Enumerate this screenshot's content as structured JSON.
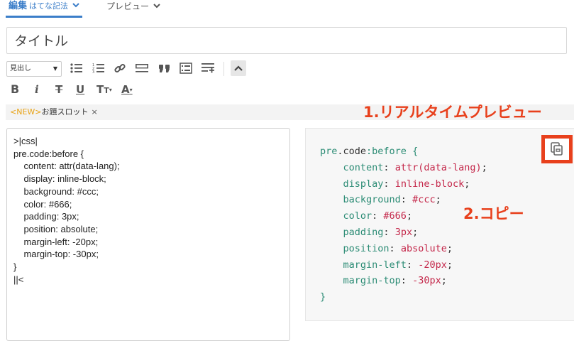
{
  "tabs": {
    "edit_label": "編集",
    "edit_mode": "はてな記法",
    "preview_label": "プレビュー"
  },
  "title_field": {
    "placeholder": "タイトル"
  },
  "toolbar": {
    "heading_select": "見出し"
  },
  "toolbar2": {
    "bold": "B",
    "italic": "i",
    "strike": "T",
    "underline": "U",
    "font_size": "T",
    "font_size_small": "T",
    "color": "A"
  },
  "topic_slot": {
    "new_badge": "<NEW>",
    "label": "お題スロット",
    "close": "×"
  },
  "annotations": {
    "realtime_preview": "1.リアルタイムプレビュー",
    "copy": "2.コピー"
  },
  "editor": {
    "content": ">|css|\npre.code:before {\n    content: attr(data-lang);\n    display: inline-block;\n    background: #ccc;\n    color: #666;\n    padding: 3px;\n    position: absolute;\n    margin-left: -20px;\n    margin-top: -30px;\n}\n||<"
  },
  "preview": {
    "selector_a": "pre",
    "selector_b": ".code",
    "selector_c": ":before",
    "open_brace": "{",
    "close_brace": "}",
    "props": [
      {
        "name": "content",
        "value": "attr(data-lang)"
      },
      {
        "name": "display",
        "value": "inline-block"
      },
      {
        "name": "background",
        "value": "#ccc"
      },
      {
        "name": "color",
        "value": "#666"
      },
      {
        "name": "padding",
        "value": "3px"
      },
      {
        "name": "position",
        "value": "absolute"
      },
      {
        "name": "margin-left",
        "value": "-20px"
      },
      {
        "name": "margin-top",
        "value": "-30px"
      }
    ]
  },
  "colors": {
    "accent_blue": "#3b7ec9",
    "annotation_red": "#e8401c",
    "new_badge": "#e8a317",
    "code_green": "#2c8c75",
    "code_red": "#c4274a"
  }
}
